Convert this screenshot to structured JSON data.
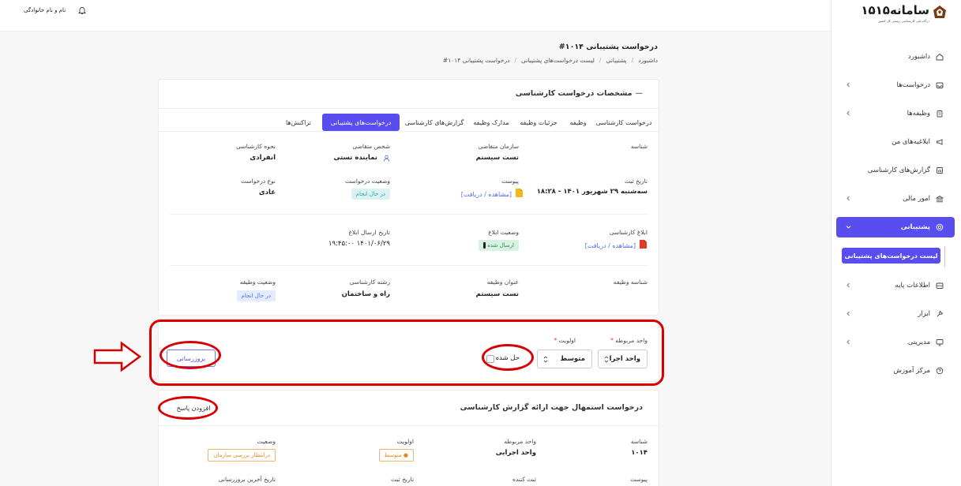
{
  "topbar": {
    "user_name": "نام و نام خانوادگی"
  },
  "brand": {
    "title": "سامانه۱۵۱۵",
    "subtitle": "درگاه ملی کارشناسی رسمی کل کشور"
  },
  "sidebar": {
    "items": [
      {
        "label": "داشبورد",
        "icon": "home-icon",
        "chevron": false
      },
      {
        "label": "درخواست‌ها",
        "icon": "inbox-icon",
        "chevron": true
      },
      {
        "label": "وظیفه‌ها",
        "icon": "clipboard-icon",
        "chevron": true
      },
      {
        "label": "ابلاغیه‌های من",
        "icon": "megaphone-icon",
        "chevron": false
      },
      {
        "label": "گزارش‌های کارشناسی",
        "icon": "report-icon",
        "chevron": false
      },
      {
        "label": "امور مالی",
        "icon": "bank-icon",
        "chevron": true
      },
      {
        "label": "پشتیبانی",
        "icon": "support-icon",
        "chevron": true,
        "active": true
      },
      {
        "label": "اطلاعات پایه",
        "icon": "database-icon",
        "chevron": true
      },
      {
        "label": "ابزار",
        "icon": "wrench-icon",
        "chevron": true
      },
      {
        "label": "مدیریتی",
        "icon": "monitor-icon",
        "chevron": true
      },
      {
        "label": "مرکز آموزش",
        "icon": "help-icon",
        "chevron": false
      }
    ],
    "sub_item": "لیست درخواست‌های پشتیبانی"
  },
  "page": {
    "title": "درخواست پشتیبانی ۱۰۱۴#",
    "breadcrumb": [
      "داشبورد",
      "پشتیبانی",
      "لیست درخواست‌های پشتیبانی",
      "درخواست پشتیبانی ۱۰۱۴#"
    ]
  },
  "details_card": {
    "title": "مشخصات درخواست کارشناسی",
    "tabs": [
      "درخواست کارشناسی",
      "وظیفه",
      "جزئیات وظیفه",
      "مدارک وظیفه",
      "گزارش‌های کارشناسی",
      "درخواست‌های پشتیبانی",
      "تراکنش‌ها"
    ],
    "active_tab": "درخواست‌های پشتیبانی",
    "fields": {
      "id_label": "شناسه",
      "org_label": "سازمان متقاضی",
      "org_value": "تست سیستم",
      "applicant_label": "شخص متقاضی",
      "applicant_value": "نماینده تستی",
      "method_label": "نحوه کارشناسی",
      "method_value": "انفرادی",
      "reg_date_label": "تاریخ ثبت",
      "reg_date_value": "سه‌شنبه ۲۹ شهریور ۱۴۰۱ - ۱۸:۲۸",
      "attach_label": "پیوست",
      "attach_link": "[مشاهده / دریافت]",
      "req_status_label": "وضعیت درخواست",
      "req_status_value": "در حال انجام",
      "req_type_label": "نوع درخواست",
      "req_type_value": "عادی",
      "notice_label": "ابلاغ کارشناسی",
      "notice_link": "[مشاهده / دریافت]",
      "notice_status_label": "وضعیت ابلاغ",
      "notice_status_value": "ارسال شده",
      "notice_date_label": "تاریخ ارسال ابلاغ",
      "notice_date_value": "۱۴۰۱/۰۶/۲۹ ۱۹:۴۵:۰۰",
      "task_id_label": "شناسه وظیفه",
      "task_title_label": "عنوان وظیفه",
      "task_title_value": "تست سیستم",
      "field_label": "رشته کارشناسی",
      "field_value": "راه و ساختمان",
      "task_status_label": "وضعیت وظیفه",
      "task_status_value": "در حال انجام"
    }
  },
  "form": {
    "unit_label": "واحد مربوطه",
    "unit_value": "واحد اجرا",
    "priority_label": "اولویت",
    "priority_value": "متوسط",
    "resolved_label": "حل شده",
    "update_button": "بروزرسانی",
    "required_mark": "*"
  },
  "request_card": {
    "title": "درخواست استمهال جهت ارائه گزارش کارشناسی",
    "add_reply_button": "افزودن پاسخ",
    "id_label": "شناسه",
    "id_value": "۱۰۱۴",
    "unit_label": "واحد مربوطه",
    "unit_value": "واحد اجرایی",
    "priority_label": "اولویت",
    "priority_value": "● متوسط",
    "status_label": "وضعیت",
    "status_value": "درانتظار بررسی سازمان",
    "attach_label": "پیوست",
    "creator_label": "ثبت کننده",
    "reg_date_label": "تاریخ ثبت",
    "last_update_label": "تاریخ آخرین بروزرسانی"
  },
  "colors": {
    "accent": "#5a4df0",
    "annotation": "#d80000"
  }
}
